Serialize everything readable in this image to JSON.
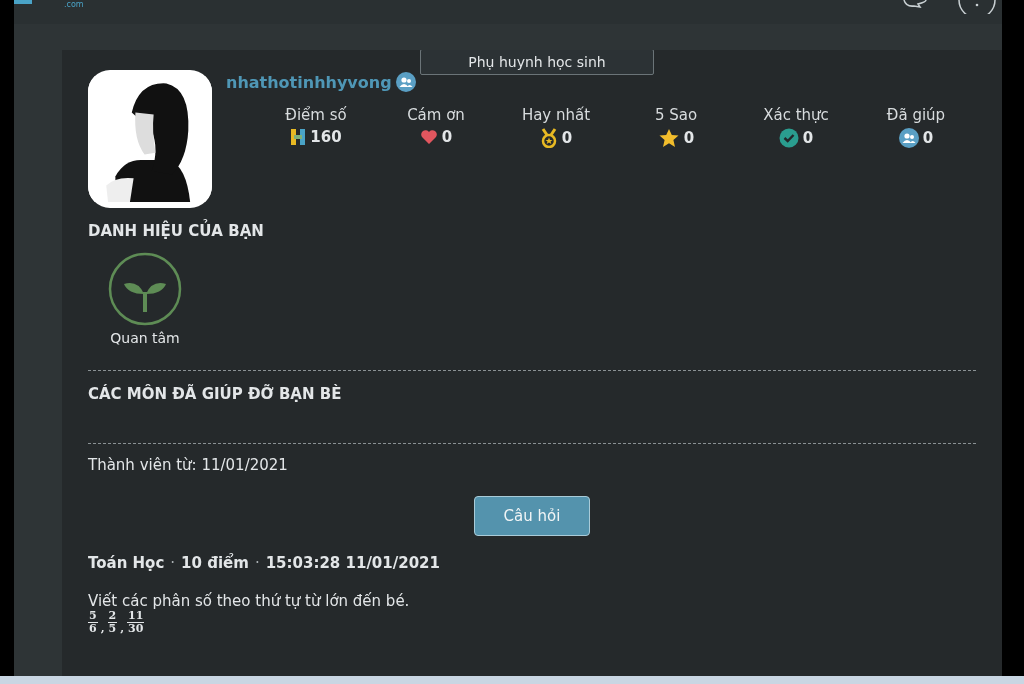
{
  "header": {
    "logo_suffix": ".com"
  },
  "profile": {
    "role_badge": "Phụ huynh học sinh",
    "username": "nhathotinhhyvong",
    "stats": [
      {
        "label": "Điểm số",
        "kind": "points",
        "value": "160"
      },
      {
        "label": "Cám ơn",
        "kind": "heart",
        "value": "0"
      },
      {
        "label": "Hay nhất",
        "kind": "medal",
        "value": "0"
      },
      {
        "label": "5 Sao",
        "kind": "star",
        "value": "0"
      },
      {
        "label": "Xác thực",
        "kind": "verified",
        "value": "0"
      },
      {
        "label": "Đã giúp",
        "kind": "helped",
        "value": "0"
      }
    ]
  },
  "titles": {
    "heading": "DANH HIỆU CỦA BẠN",
    "items": [
      {
        "label": "Quan tâm"
      }
    ]
  },
  "subjects": {
    "heading": "CÁC MÔN ĐÃ GIÚP ĐỠ BẠN BÈ"
  },
  "member_since": "Thành viên từ: 11/01/2021",
  "questions_button": "Câu hỏi",
  "question": {
    "subject": "Toán Học",
    "points": "10 điểm",
    "time": "15:03:28 11/01/2021",
    "separators": [
      "·",
      "·"
    ],
    "fraction_separators": [
      ",",
      ","
    ],
    "text": "Viết các phân số theo thứ tự từ lớn đến bé.",
    "fractions": [
      {
        "num": "5",
        "den": "6"
      },
      {
        "num": "2",
        "den": "5"
      },
      {
        "num": "11",
        "den": "30"
      }
    ]
  }
}
